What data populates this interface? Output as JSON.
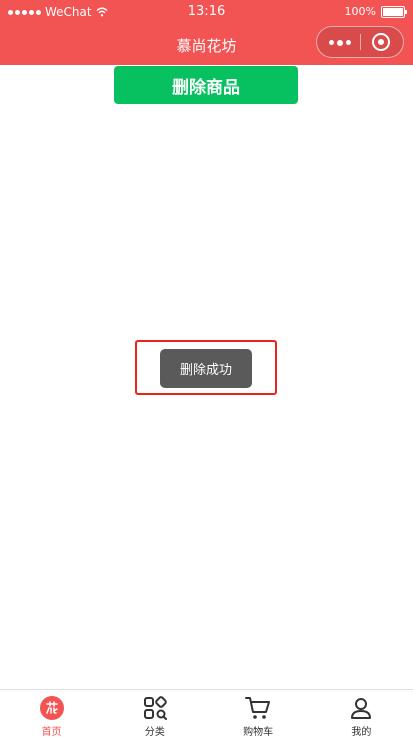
{
  "status_bar": {
    "carrier": "WeChat",
    "time": "13:16",
    "battery": "100%"
  },
  "nav": {
    "title": "慕尚花坊"
  },
  "main": {
    "delete_button_label": "删除商品",
    "toast_text": "删除成功"
  },
  "tabbar": {
    "items": [
      {
        "label": "首页",
        "icon": "flower-home-icon",
        "active": true
      },
      {
        "label": "分类",
        "icon": "category-grid-icon",
        "active": false
      },
      {
        "label": "购物车",
        "icon": "cart-icon",
        "active": false
      },
      {
        "label": "我的",
        "icon": "user-icon",
        "active": false
      }
    ]
  },
  "colors": {
    "header": "#f25353",
    "primary_button": "#07c160",
    "toast": "#5a5a5a",
    "highlight_border": "#e8251b",
    "active_tab": "#f25353"
  }
}
